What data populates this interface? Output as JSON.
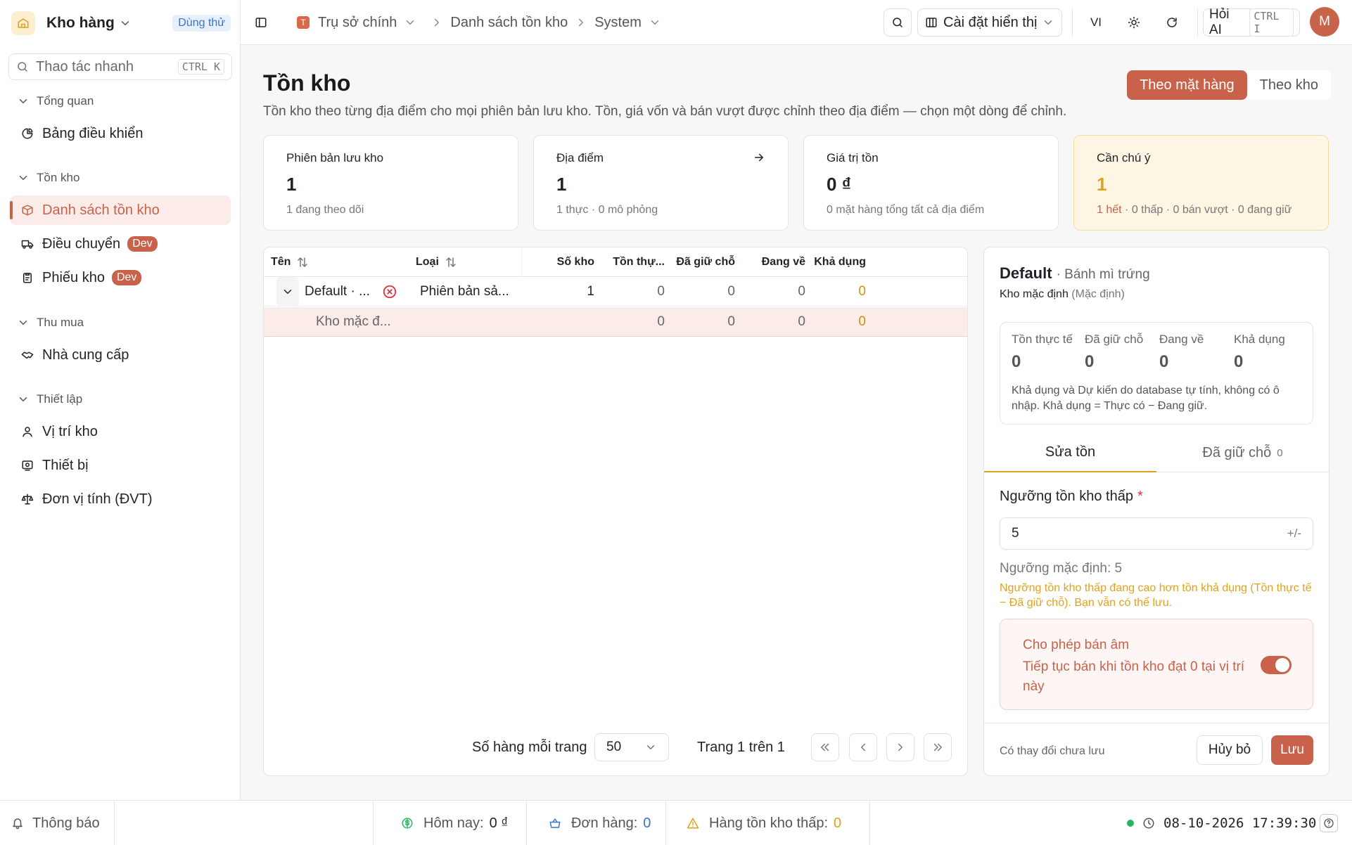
{
  "app": {
    "name": "Kho hàng",
    "trial_badge": "Dùng thử"
  },
  "quick_action": {
    "placeholder": "Thao tác nhanh",
    "shortcut": "CTRL K"
  },
  "sidebar": {
    "groups": [
      "Tổng quan",
      "Tồn kho",
      "Thu mua",
      "Thiết lập"
    ],
    "items": [
      {
        "label": "Bảng điều khiển",
        "icon": "pie-chart-icon"
      },
      {
        "label": "Danh sách tồn kho",
        "icon": "package-icon",
        "active": true
      },
      {
        "label": "Điều chuyển",
        "icon": "truck-icon",
        "badge": "Dev"
      },
      {
        "label": "Phiếu kho",
        "icon": "clipboard-icon",
        "badge": "Dev"
      },
      {
        "label": "Nhà cung cấp",
        "icon": "handshake-icon"
      },
      {
        "label": "Vị trí kho",
        "icon": "map-pin-icon"
      },
      {
        "label": "Thiết bị",
        "icon": "device-icon"
      },
      {
        "label": "Đơn vị tính (ĐVT)",
        "icon": "scale-icon"
      }
    ]
  },
  "topbar": {
    "breadcrumb": [
      "Trụ sở chính",
      "Danh sách tồn kho",
      "System"
    ],
    "branch_initial": "T",
    "display_settings": "Cài đặt hiển thị",
    "lang": "VI",
    "ask_ai": "Hỏi AI",
    "ask_ai_shortcut": "CTRL I",
    "avatar_initial": "M"
  },
  "page": {
    "title": "Tồn kho",
    "subtitle": "Tồn kho theo từng địa điểm cho mọi phiên bản lưu kho. Tồn, giá vốn và bán vượt được chỉnh theo địa điểm — chọn một dòng để chỉnh.",
    "view_toggle": [
      "Theo mặt hàng",
      "Theo kho"
    ],
    "view_active": "Theo mặt hàng"
  },
  "cards": [
    {
      "title": "Phiên bản lưu kho",
      "value": "1",
      "sub": "1 đang theo dõi"
    },
    {
      "title": "Địa điểm",
      "value": "1",
      "sub": "1 thực · 0 mô phỏng"
    },
    {
      "title": "Giá trị tồn",
      "value": "0 ₫",
      "sub": "0 mặt hàng tổng tất cả địa điểm"
    },
    {
      "title": "Cần chú ý",
      "value": "1",
      "sub_highlight": "1 hết",
      "sub_rest": " · 0 thấp · 0 bán vượt · 0 đang giữ"
    }
  ],
  "table": {
    "columns": [
      "Tên",
      "Loại",
      "Số kho",
      "Tồn thự...",
      "Đã giữ chỗ",
      "Đang về",
      "Khả dụng"
    ],
    "rows": [
      {
        "name": "Default · ...",
        "type": "Phiên bản sả...",
        "locations": "1",
        "on_hand": "0",
        "reserved": "0",
        "incoming": "0",
        "available": "0"
      },
      {
        "name": "Kho mặc đ...",
        "type": "",
        "locations": "",
        "on_hand": "0",
        "reserved": "0",
        "incoming": "0",
        "available": "0"
      }
    ],
    "rows_per_page_label": "Số hàng mỗi trang",
    "rows_per_page": "50",
    "page_info": "Trang 1 trên 1"
  },
  "detail": {
    "title": "Default",
    "title_sub": "· Bánh mì trứng",
    "location": "Kho mặc định",
    "location_note": "(Mặc định)",
    "stats": [
      {
        "label": "Tồn thực tế",
        "value": "0"
      },
      {
        "label": "Đã giữ chỗ",
        "value": "0"
      },
      {
        "label": "Đang về",
        "value": "0"
      },
      {
        "label": "Khả dụng",
        "value": "0"
      }
    ],
    "stats_note": "Khả dụng và Dự kiến do database tự tính, không có ô nhập. Khả dụng = Thực có − Đang giữ.",
    "tabs": [
      {
        "label": "Sửa tồn",
        "count": ""
      },
      {
        "label": "Đã giữ chỗ",
        "count": "0"
      }
    ],
    "threshold_label": "Ngưỡng tồn kho thấp",
    "threshold_value": "5",
    "threshold_suffix": "+/-",
    "default_threshold": "Ngưỡng mặc định: 5",
    "warning": "Ngưỡng tồn kho thấp đang cao hơn tồn khả dụng (Tồn thực tế − Đã giữ chỗ). Bạn vẫn có thể lưu.",
    "negative_title": "Cho phép bán âm",
    "negative_desc": "Tiếp tục bán khi tồn kho đạt 0 tại vị trí này",
    "negative_enabled": true,
    "unsaved": "Có thay đổi chưa lưu",
    "cancel": "Hủy bỏ",
    "save": "Lưu"
  },
  "statusbar": {
    "notifications": "Thông báo",
    "today_label": "Hôm nay:",
    "today_value": "0 ₫",
    "orders_label": "Đơn hàng:",
    "orders_value": "0",
    "low_stock_label": "Hàng tồn kho thấp:",
    "low_stock_value": "0",
    "datetime": "08-10-2026 17:39:30"
  },
  "colors": {
    "accent": "#c8624a",
    "warning": "#e0a21c",
    "trial": "#3a76c4",
    "online": "#27b561"
  }
}
